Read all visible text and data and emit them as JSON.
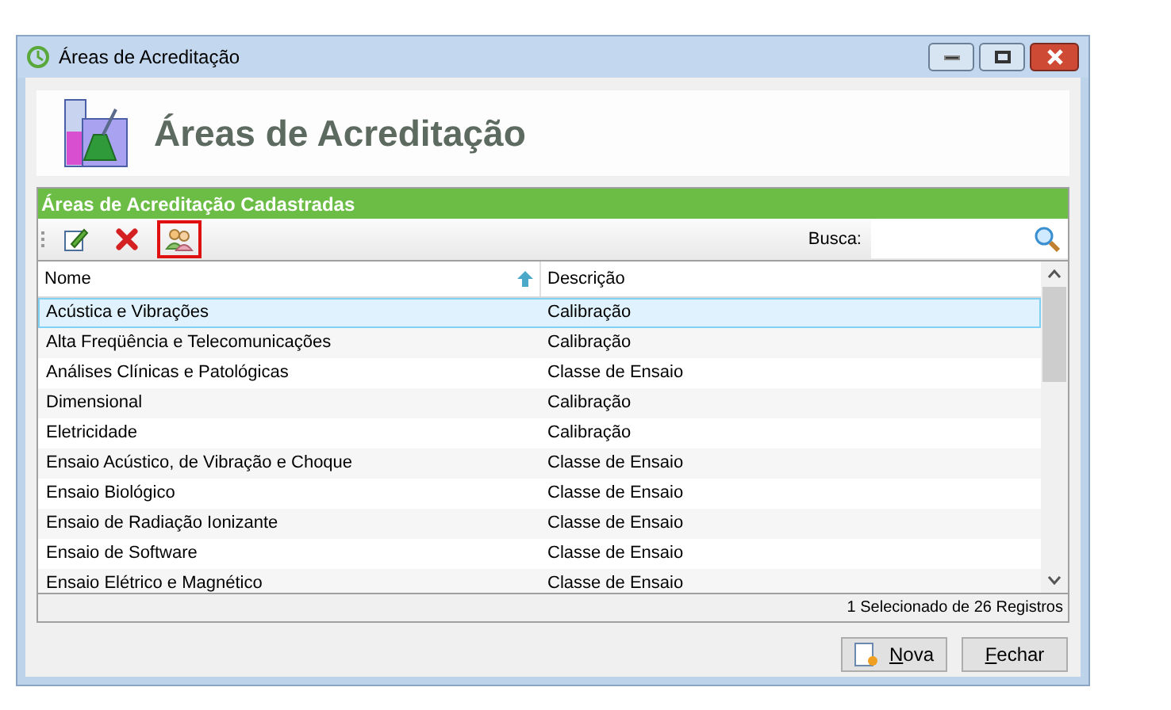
{
  "window": {
    "title": "Áreas de Acreditação"
  },
  "header": {
    "title": "Áreas de Acreditação"
  },
  "panel": {
    "title": "Áreas de Acreditação Cadastradas"
  },
  "toolbar": {
    "tools": [
      {
        "kind": "edit",
        "highlighted": false
      },
      {
        "kind": "delete",
        "highlighted": false
      },
      {
        "kind": "users",
        "highlighted": true
      }
    ],
    "search_label": "Busca:"
  },
  "table": {
    "columns": [
      {
        "label": "Nome",
        "sorted": true
      },
      {
        "label": "Descrição",
        "sorted": false
      }
    ],
    "rows": [
      {
        "name": "Acústica e Vibrações",
        "description": "Calibração",
        "selected": true
      },
      {
        "name": "Alta Freqüência e Telecomunicações",
        "description": "Calibração",
        "selected": false
      },
      {
        "name": "Análises Clínicas e Patológicas",
        "description": "Classe de Ensaio",
        "selected": false
      },
      {
        "name": "Dimensional",
        "description": "Calibração",
        "selected": false
      },
      {
        "name": "Eletricidade",
        "description": "Calibração",
        "selected": false
      },
      {
        "name": "Ensaio Acústico, de Vibração e Choque",
        "description": "Classe de Ensaio",
        "selected": false
      },
      {
        "name": "Ensaio Biológico",
        "description": "Classe de Ensaio",
        "selected": false
      },
      {
        "name": "Ensaio de Radiação Ionizante",
        "description": "Classe de Ensaio",
        "selected": false
      },
      {
        "name": "Ensaio de Software",
        "description": "Classe de Ensaio",
        "selected": false
      },
      {
        "name": "Ensaio Elétrico e Magnético",
        "description": "Classe de Ensaio",
        "selected": false
      }
    ]
  },
  "status_bar": "1 Selecionado de 26 Registros",
  "buttons": [
    {
      "label": "Nova",
      "kind": "new",
      "access_key": true
    },
    {
      "label": "Fechar",
      "kind": "close",
      "access_key": true
    }
  ]
}
